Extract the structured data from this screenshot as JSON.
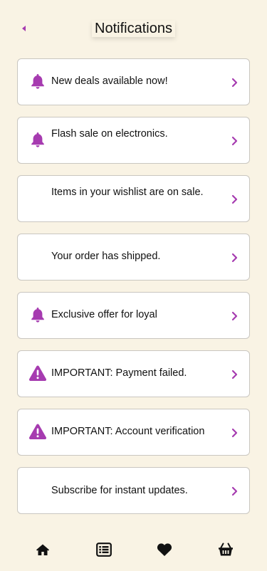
{
  "header": {
    "title": "Notifications",
    "back_icon": "chevron-left-icon"
  },
  "colors": {
    "accent": "#a63bb0",
    "background": "#f9f3e4",
    "card_border": "#c9c6c0",
    "card_bg": "#ffffff"
  },
  "notifications": [
    {
      "icon": "bell-icon",
      "text": "New deals available now!"
    },
    {
      "icon": "bell-icon",
      "text": "Flash sale on electronics."
    },
    {
      "icon": "none",
      "text": "Items in your wishlist are on sale."
    },
    {
      "icon": "none",
      "text": "Your order has shipped."
    },
    {
      "icon": "bell-icon",
      "text": "Exclusive offer for loyal"
    },
    {
      "icon": "warning-icon",
      "text": "IMPORTANT: Payment failed."
    },
    {
      "icon": "warning-icon",
      "text": "IMPORTANT: Account verification"
    },
    {
      "icon": "none",
      "text": "Subscribe for instant updates."
    }
  ],
  "bottom_nav": [
    {
      "icon": "home-icon"
    },
    {
      "icon": "list-icon"
    },
    {
      "icon": "heart-icon"
    },
    {
      "icon": "basket-icon"
    }
  ]
}
